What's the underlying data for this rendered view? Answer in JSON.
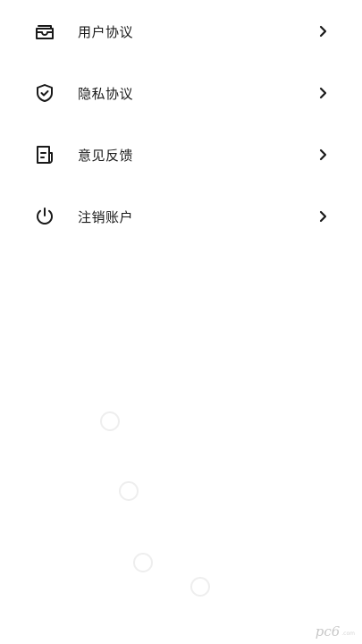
{
  "menu": {
    "items": [
      {
        "icon": "envelope-icon",
        "label": "用户协议"
      },
      {
        "icon": "shield-check-icon",
        "label": "隐私协议"
      },
      {
        "icon": "document-icon",
        "label": "意见反馈"
      },
      {
        "icon": "power-icon",
        "label": "注销账户"
      }
    ]
  },
  "loading": {
    "icon": "loading-spinner-icon"
  },
  "watermark": {
    "logo": "pc6",
    "sub": ".com"
  },
  "colors": {
    "text": "#1a1a1a",
    "background": "#ffffff",
    "spinner": "#eeeeee"
  }
}
